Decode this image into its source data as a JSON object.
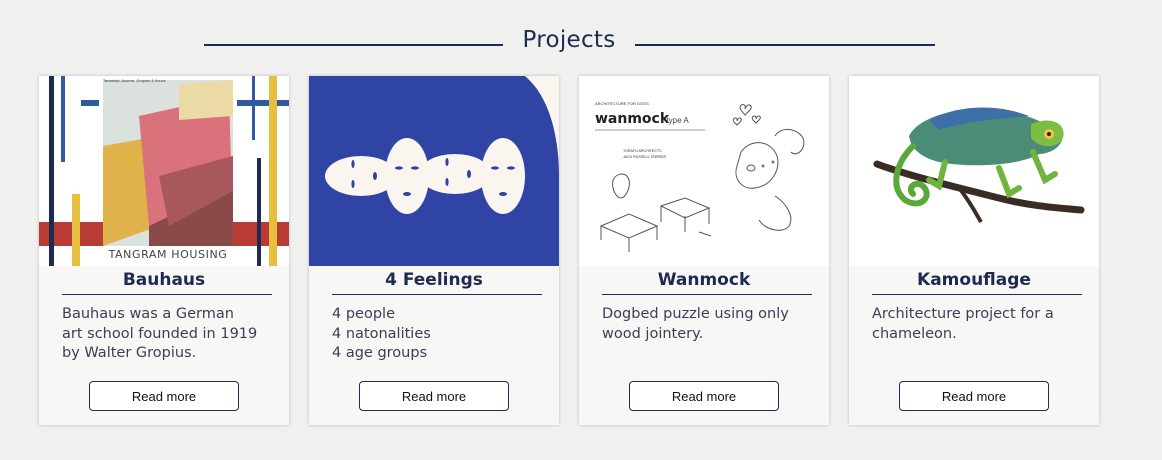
{
  "section": {
    "title": "Projects"
  },
  "projects": [
    {
      "name": "Bauhaus",
      "description": "Bauhaus was a German\nart school founded in 1919\nby Walter Gropius.",
      "button": "Read more",
      "image_caption": "TANGRAM HOUSING",
      "image_small_text": "Tarantola, Azuma, Gropius & Itoucz"
    },
    {
      "name": "4 Feelings",
      "description": "4 people\n4 natonalities\n4 age groups",
      "button": "Read more"
    },
    {
      "name": "Wanmock",
      "description": "Dogbed puzzle using only\nwood jointery.",
      "button": "Read more",
      "image_title": "wanmock",
      "image_subtitle": "/ type A",
      "image_top": "ARCHITECTURE FOR DOGS",
      "image_credit1": "TORAFU ARCHITECTS",
      "image_credit2": "JACK RUSSELL TERRIER"
    },
    {
      "name": "Kamouflage",
      "description": "Architecture project for a\nchameleon.",
      "button": "Read more"
    }
  ]
}
